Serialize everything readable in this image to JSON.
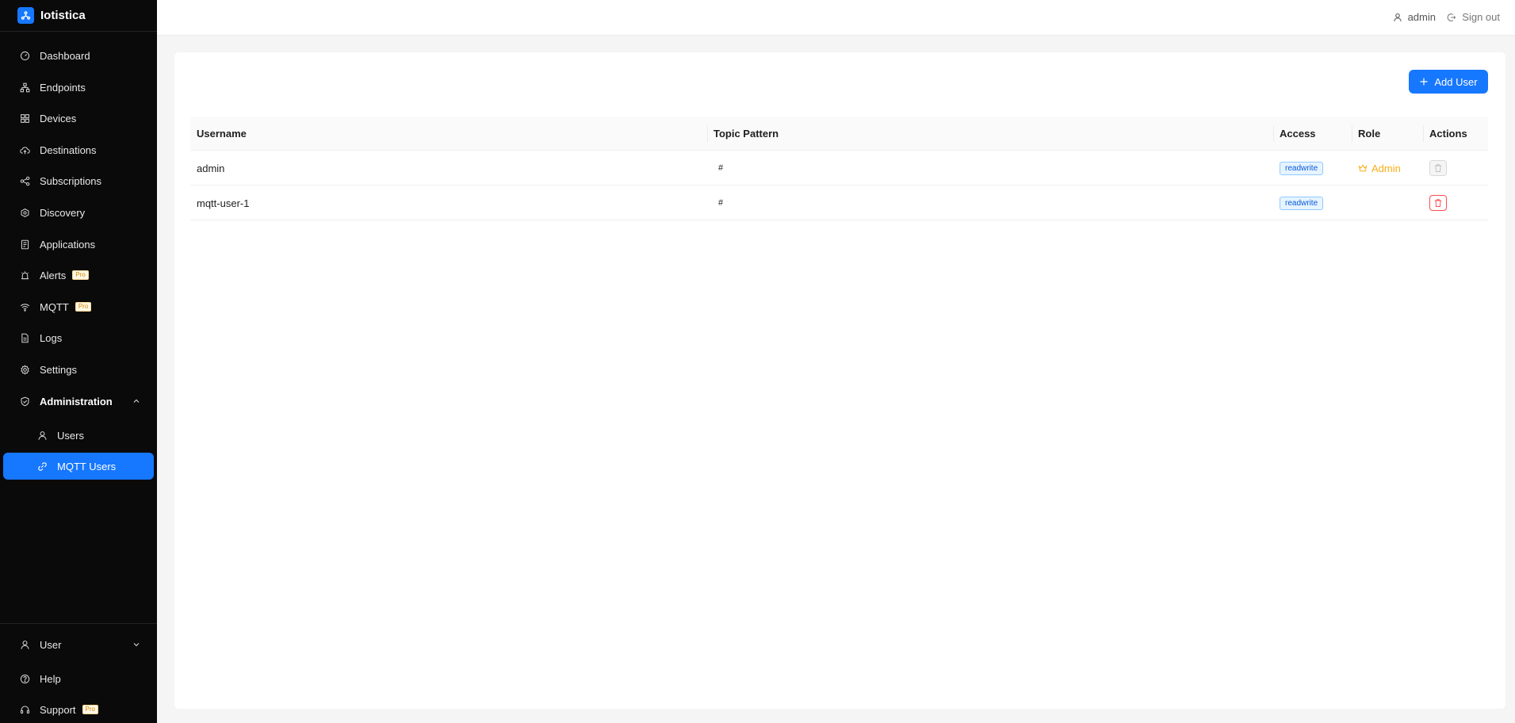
{
  "app": {
    "name": "Iotistica",
    "logo_icon": "tree-network-icon"
  },
  "sidebar": {
    "items": [
      {
        "label": "Dashboard",
        "icon": "dashboard-icon"
      },
      {
        "label": "Endpoints",
        "icon": "endpoints-icon"
      },
      {
        "label": "Devices",
        "icon": "devices-icon"
      },
      {
        "label": "Destinations",
        "icon": "cloud-upload-icon"
      },
      {
        "label": "Subscriptions",
        "icon": "share-icon"
      },
      {
        "label": "Discovery",
        "icon": "radar-icon"
      },
      {
        "label": "Applications",
        "icon": "applications-icon"
      },
      {
        "label": "Alerts",
        "icon": "alarm-icon",
        "badge": "Pro"
      },
      {
        "label": "MQTT",
        "icon": "wifi-icon",
        "badge": "Pro"
      },
      {
        "label": "Logs",
        "icon": "file-icon"
      },
      {
        "label": "Settings",
        "icon": "gear-icon"
      }
    ],
    "admin_group": {
      "label": "Administration",
      "icon": "shield-icon",
      "children": [
        {
          "label": "Users",
          "icon": "user-icon"
        },
        {
          "label": "MQTT Users",
          "icon": "link-icon",
          "active": true
        }
      ]
    },
    "bottom": [
      {
        "label": "User",
        "icon": "user-icon"
      },
      {
        "label": "Help",
        "icon": "question-icon"
      },
      {
        "label": "Support",
        "icon": "headset-icon",
        "badge": "Pro"
      }
    ]
  },
  "header": {
    "user_label": "admin",
    "signout_label": "Sign out"
  },
  "toolbar": {
    "add_user_label": "Add User"
  },
  "table": {
    "columns": [
      "Username",
      "Topic Pattern",
      "Access",
      "Role",
      "Actions"
    ],
    "rows": [
      {
        "username": "admin",
        "topic": "#",
        "access": "readwrite",
        "role": "Admin",
        "delete_enabled": false
      },
      {
        "username": "mqtt-user-1",
        "topic": "#",
        "access": "readwrite",
        "role": "",
        "delete_enabled": true
      }
    ]
  },
  "colors": {
    "accent": "#1677ff",
    "sidebar_bg": "#0a0a0a",
    "admin_role": "#faad14",
    "danger": "#ff4d4f"
  }
}
